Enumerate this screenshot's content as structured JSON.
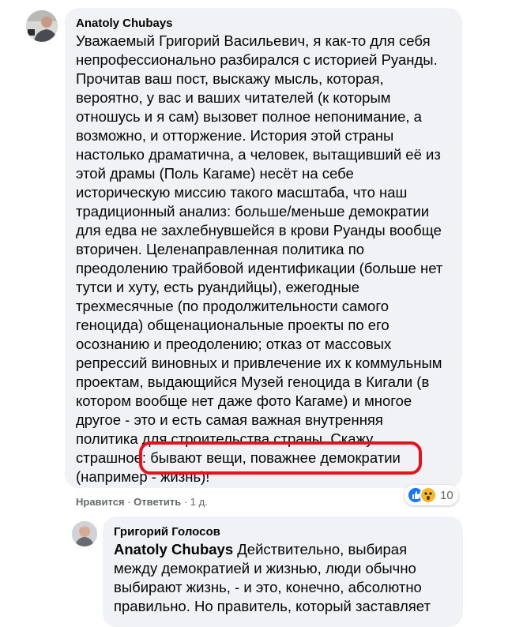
{
  "comment": {
    "author": "Anatoly Chubays",
    "lines": [
      "Уважаемый Григорий Васильевич, я как-то для себя",
      "непрофессионально разбирался с историей Руанды.",
      "Прочитав ваш пост, выскажу мысль, которая,",
      "вероятно, у вас и ваших читателей (к которым",
      "отношусь и я сам) вызовет полное непонимание, а",
      "возможно, и отторжение. История этой страны",
      "настолько драматична, а человек, вытащивший её из",
      "этой драмы (Поль Кагаме) несёт на себе",
      "историческую миссию такого масштаба, что наш",
      "традиционный анализ: больше/меньше демократии",
      "для едва не захлебнувшейся в крови Руанды вообще",
      "вторичен. Целенаправленная политика по",
      "преодолению трайбовой идентификации (больше нет",
      "тутси и хуту, есть руандийцы), ежегодные",
      "трехмесячные (по продолжительности самого",
      "геноцида) общенациональные проекты по его",
      "осознанию и преодолению; отказ от массовых",
      "репрессий виновных и привлечение их к коммульным",
      "проектам, выдающийся Музей геноцида в Кигали (в",
      "котором вообще нет даже фото Кагаме) и многое",
      "другое - это и есть самая важная внутренняя",
      "политика для строительства страны. Скажу",
      "страшное: бывают вещи, поважнее демократии",
      "(например - жизнь)!"
    ],
    "like_label": "Нравится",
    "reply_label": "Ответить",
    "time": "1 д.",
    "separator": "·",
    "reaction_count": "10",
    "reaction_icons": [
      "like-icon",
      "wow-icon"
    ]
  },
  "reply": {
    "author": "Григорий Голосов",
    "mention": "Anatoly Chubays",
    "first_line_rest": " Действительно, выбирая",
    "lines": [
      "между демократией и жизнью, люди обычно",
      "выбирают жизнь, - и это, конечно, абсолютно",
      "правильно. Но правитель, который заставляет"
    ]
  },
  "colors": {
    "bubble": "#f0f2f5",
    "meta": "#65676b",
    "highlight": "#e8101a",
    "like": "#1877f2",
    "wow": "#f7b928"
  }
}
